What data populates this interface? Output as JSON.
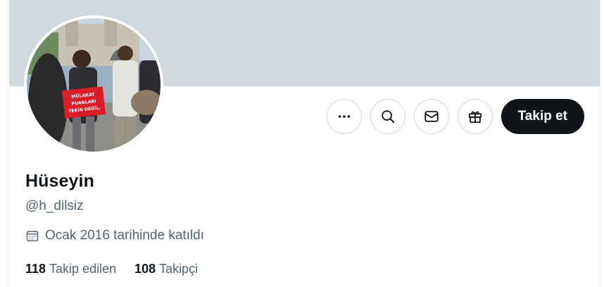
{
  "profile": {
    "display_name": "Hüseyin",
    "handle": "@h_dilsiz",
    "joined_text": "Ocak 2016 tarihinde katıldı",
    "avatar_sign_text": [
      "MÜLAKAT",
      "PUANLARI",
      "TEKİN DEĞİL."
    ]
  },
  "actions": {
    "more_icon": "more-icon",
    "search_icon": "search-icon",
    "message_icon": "mail-icon",
    "gift_icon": "gift-icon",
    "follow_label": "Takip et"
  },
  "stats": {
    "following_count": "118",
    "following_label": "Takip edilen",
    "followers_count": "108",
    "followers_label": "Takipçi"
  },
  "colors": {
    "banner": "#cfd9de",
    "primary_text": "#0f1419",
    "secondary_text": "#536471",
    "follow_button": "#0f1419"
  }
}
